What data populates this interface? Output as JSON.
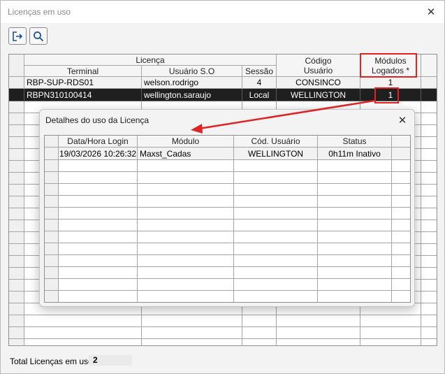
{
  "window": {
    "title": "Licenças em uso"
  },
  "toolbar": {
    "exit_icon": "exit-icon",
    "search_icon": "search-icon"
  },
  "main_grid": {
    "group_header": "Licença",
    "columns": {
      "terminal": "Terminal",
      "usuario_so": "Usuário S.O",
      "sessao": "Sessão",
      "codigo_usuario_line1": "Código",
      "codigo_usuario_line2": "Usuário",
      "modulos_line1": "Módulos",
      "modulos_line2": "Logados *"
    },
    "rows": [
      {
        "terminal": "RBP-SUP-RDS01",
        "usuario_so": "welson.rodrigo",
        "sessao": "4",
        "codigo": "CONSINCO",
        "modulos": "1"
      },
      {
        "terminal": "RBPN310100414",
        "usuario_so": "wellington.saraujo",
        "sessao": "Local",
        "codigo": "WELLINGTON",
        "modulos": "1"
      }
    ]
  },
  "footer": {
    "label": "Total Licenças em uso:",
    "value": "2"
  },
  "modal": {
    "title": "Detalhes do uso da Licença",
    "columns": {
      "data_hora": "Data/Hora Login",
      "modulo": "Módulo",
      "cod_usuario": "Cód. Usuário",
      "status": "Status"
    },
    "rows": [
      {
        "data_hora": "19/03/2026 10:26:32",
        "modulo": "Maxst_Cadas",
        "cod_usuario": "WELLINGTON",
        "status": "0h11m Inativo"
      }
    ]
  },
  "colors": {
    "highlight": "#e02424",
    "selected_row": "#1f1f1f"
  }
}
